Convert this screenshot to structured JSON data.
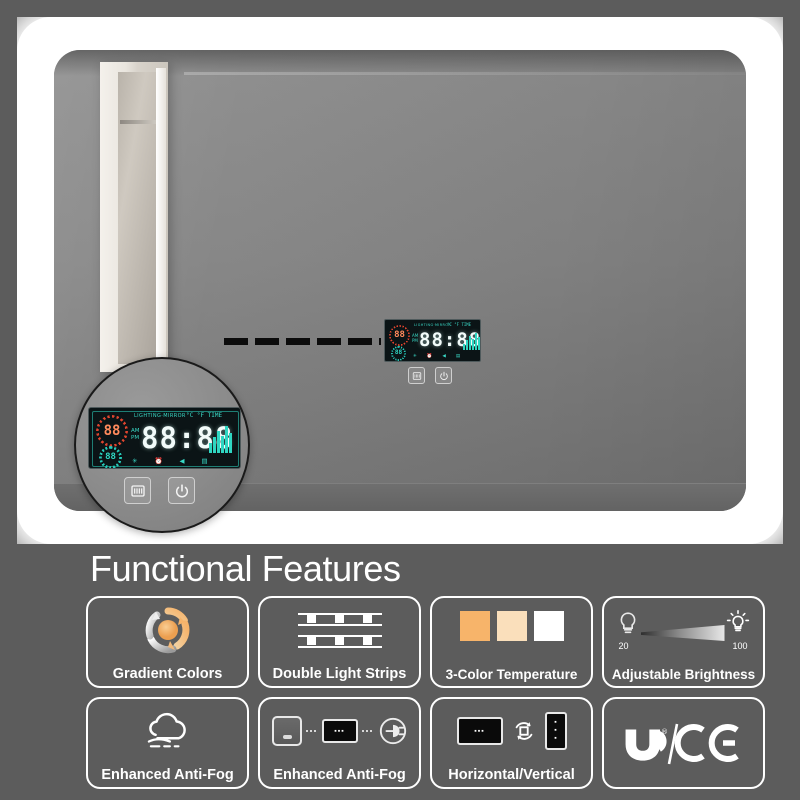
{
  "scene": {
    "name": "led-bathroom-mirror-photo",
    "door_name": "doorway-niche",
    "faucets_name": "wall-faucets",
    "leader_name": "callout-dashed-line"
  },
  "lcd": {
    "brand": "LIGHTING·MIRROR",
    "top_right": "°C  °F  TIME",
    "temp_gauge_value": "88",
    "humidity_gauge_value": "88",
    "time": "88:88",
    "am_label": "AM",
    "pm_label": "PM",
    "indicator_icons": [
      "bluetooth-icon",
      "alarm-icon",
      "speaker-icon",
      "battery-icon"
    ],
    "bar_levels": [
      5,
      9,
      13,
      10,
      16,
      12,
      18
    ],
    "buttons": [
      {
        "name": "defogger-button",
        "glyph": "defogger-icon"
      },
      {
        "name": "power-button",
        "glyph": "power-icon"
      }
    ]
  },
  "features": {
    "title": "Functional Features",
    "cards": [
      {
        "id": "gradient-colors",
        "label": "Gradient Colors",
        "icon": "gradient-cycle-icon"
      },
      {
        "id": "double-light-strips",
        "label": "Double Light Strips",
        "icon": "light-strips-icon",
        "strip_count": 2,
        "leds_per_strip": 3
      },
      {
        "id": "three-color-temperature",
        "label": "3-Color Temperature",
        "icon": "color-swatches-icon",
        "swatches": [
          "#f7b46a",
          "#fadfbb",
          "#ffffff"
        ]
      },
      {
        "id": "adjustable-brightness",
        "label": "Adjustable Brightness",
        "icon": "brightness-ramp-icon",
        "min": "20",
        "max": "100"
      },
      {
        "id": "enhanced-anti-fog-cloud",
        "label": "Enhanced Anti-Fog",
        "icon": "fog-cloud-icon"
      },
      {
        "id": "enhanced-anti-fog-wiring",
        "label": "Enhanced Anti-Fog",
        "icon": "switch-mirror-plug-icon"
      },
      {
        "id": "horizontal-vertical",
        "label": "Horizontal/Vertical",
        "icon": "rotate-orientation-icon"
      },
      {
        "id": "certifications",
        "label": "",
        "icon": "ul-ce-certification-icon",
        "ul_text": "UL",
        "separator": "/",
        "ce_text": "CE"
      }
    ]
  },
  "colors": {
    "page_background": "#5c5c5c",
    "mirror_glow": "#ffffff",
    "lcd_background": "#0b1416",
    "lcd_cyan": "#2fd6c2",
    "lcd_red": "#e0452e",
    "card_border": "#ffffff"
  }
}
